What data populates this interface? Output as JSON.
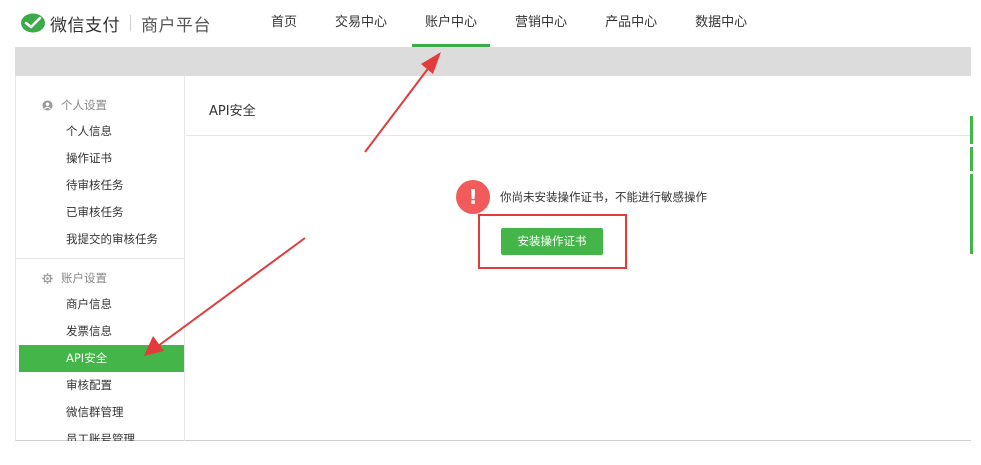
{
  "brand": {
    "name": "微信支付",
    "sub": "商户平台"
  },
  "nav": [
    {
      "label": "首页",
      "active": false
    },
    {
      "label": "交易中心",
      "active": false
    },
    {
      "label": "账户中心",
      "active": true
    },
    {
      "label": "营销中心",
      "active": false
    },
    {
      "label": "产品中心",
      "active": false
    },
    {
      "label": "数据中心",
      "active": false
    }
  ],
  "sidebar": {
    "groups": [
      {
        "title": "个人设置",
        "icon": "user-icon",
        "items": [
          "个人信息",
          "操作证书",
          "待审核任务",
          "已审核任务",
          "我提交的审核任务"
        ]
      },
      {
        "title": "账户设置",
        "icon": "gear-icon",
        "items": [
          "商户信息",
          "发票信息",
          "API安全",
          "审核配置",
          "微信群管理",
          "员工账号管理"
        ]
      }
    ],
    "active_item": "API安全"
  },
  "content": {
    "title": "API安全",
    "warning": "你尚未安装操作证书，不能进行敏感操作",
    "warning_icon": "exclamation-icon",
    "install_button": "安装操作证书"
  },
  "colors": {
    "accent": "#44b549",
    "alert": "#f15b5b",
    "annotation": "#e23b3b"
  }
}
